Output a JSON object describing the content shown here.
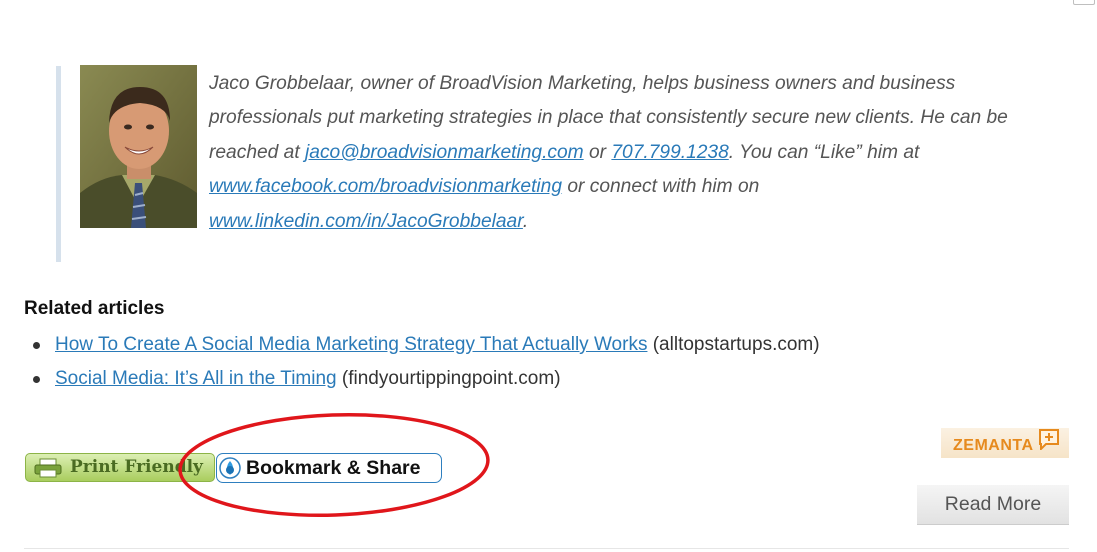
{
  "bio": {
    "photo_alt": "Jaco Grobbelaar portrait",
    "intro": "Jaco Grobbelaar, owner of BroadVision Marketing, helps business owners and business professionals put marketing strategies in place that consistently secure new clients. He can be reached at ",
    "email": "jaco@broadvisionmarketing.com",
    "or1": " or ",
    "phone": "707.799.1238",
    "like_text": ". You can “Like” him at ",
    "facebook": "www.facebook.com/broadvisionmarketing",
    "connect_text": " or connect with him on ",
    "linkedin": "www.linkedin.com/in/JacoGrobbelaar",
    "end": "."
  },
  "related": {
    "title": "Related articles",
    "items": [
      {
        "link": "How To Create A Social Media Marketing Strategy That Actually Works",
        "source": " (alltopstartups.com)"
      },
      {
        "link": "Social Media: It’s All in the Timing",
        "source": " (findyourtippingpoint.com)"
      }
    ]
  },
  "share": {
    "print_label": "Print Friendly",
    "bookmark_label": "Bookmark & Share"
  },
  "zemanta": {
    "label": "ZEMANTA"
  },
  "read_more": {
    "label": "Read More"
  },
  "colors": {
    "link": "#2a7ab8",
    "annotation": "#e0161b",
    "quote_border": "#d6e1ec"
  },
  "icons": {
    "print": "printer-icon",
    "bookmark": "addthis-icon",
    "zemanta": "zemanta-plus-icon"
  }
}
